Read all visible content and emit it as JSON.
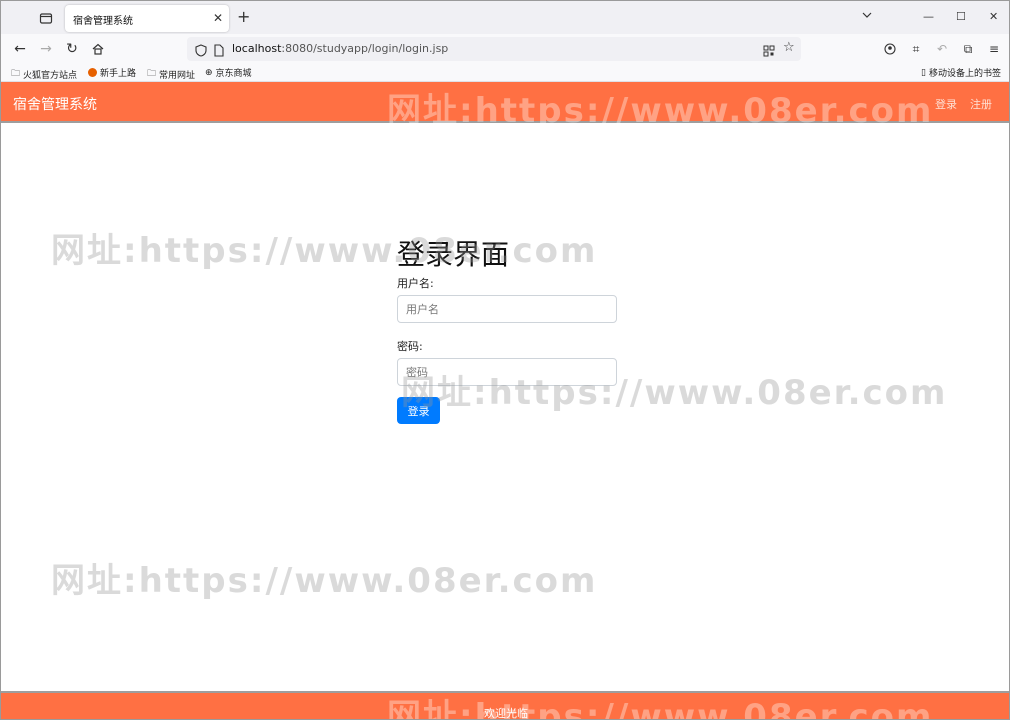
{
  "browser": {
    "tab_title": "宿舍管理系统",
    "url_host": "localhost",
    "url_rest": ":8080/studyapp/login/login.jsp",
    "bookmarks": [
      "火狐官方站点",
      "新手上路",
      "常用网址",
      "京东商城"
    ],
    "mobile_bookmarks": "移动设备上的书签"
  },
  "app": {
    "brand": "宿舍管理系统",
    "login_link": "登录",
    "register_link": "注册",
    "accent_color": "#ff7043"
  },
  "login": {
    "title": "登录界面",
    "username_label": "用户名:",
    "username_placeholder": "用户名",
    "password_label": "密码:",
    "password_placeholder": "密码",
    "submit_label": "登录",
    "button_color": "#007bff"
  },
  "footer": {
    "text": "欢迎光临"
  },
  "watermark": {
    "text": "网址:https://www.08er.com"
  }
}
